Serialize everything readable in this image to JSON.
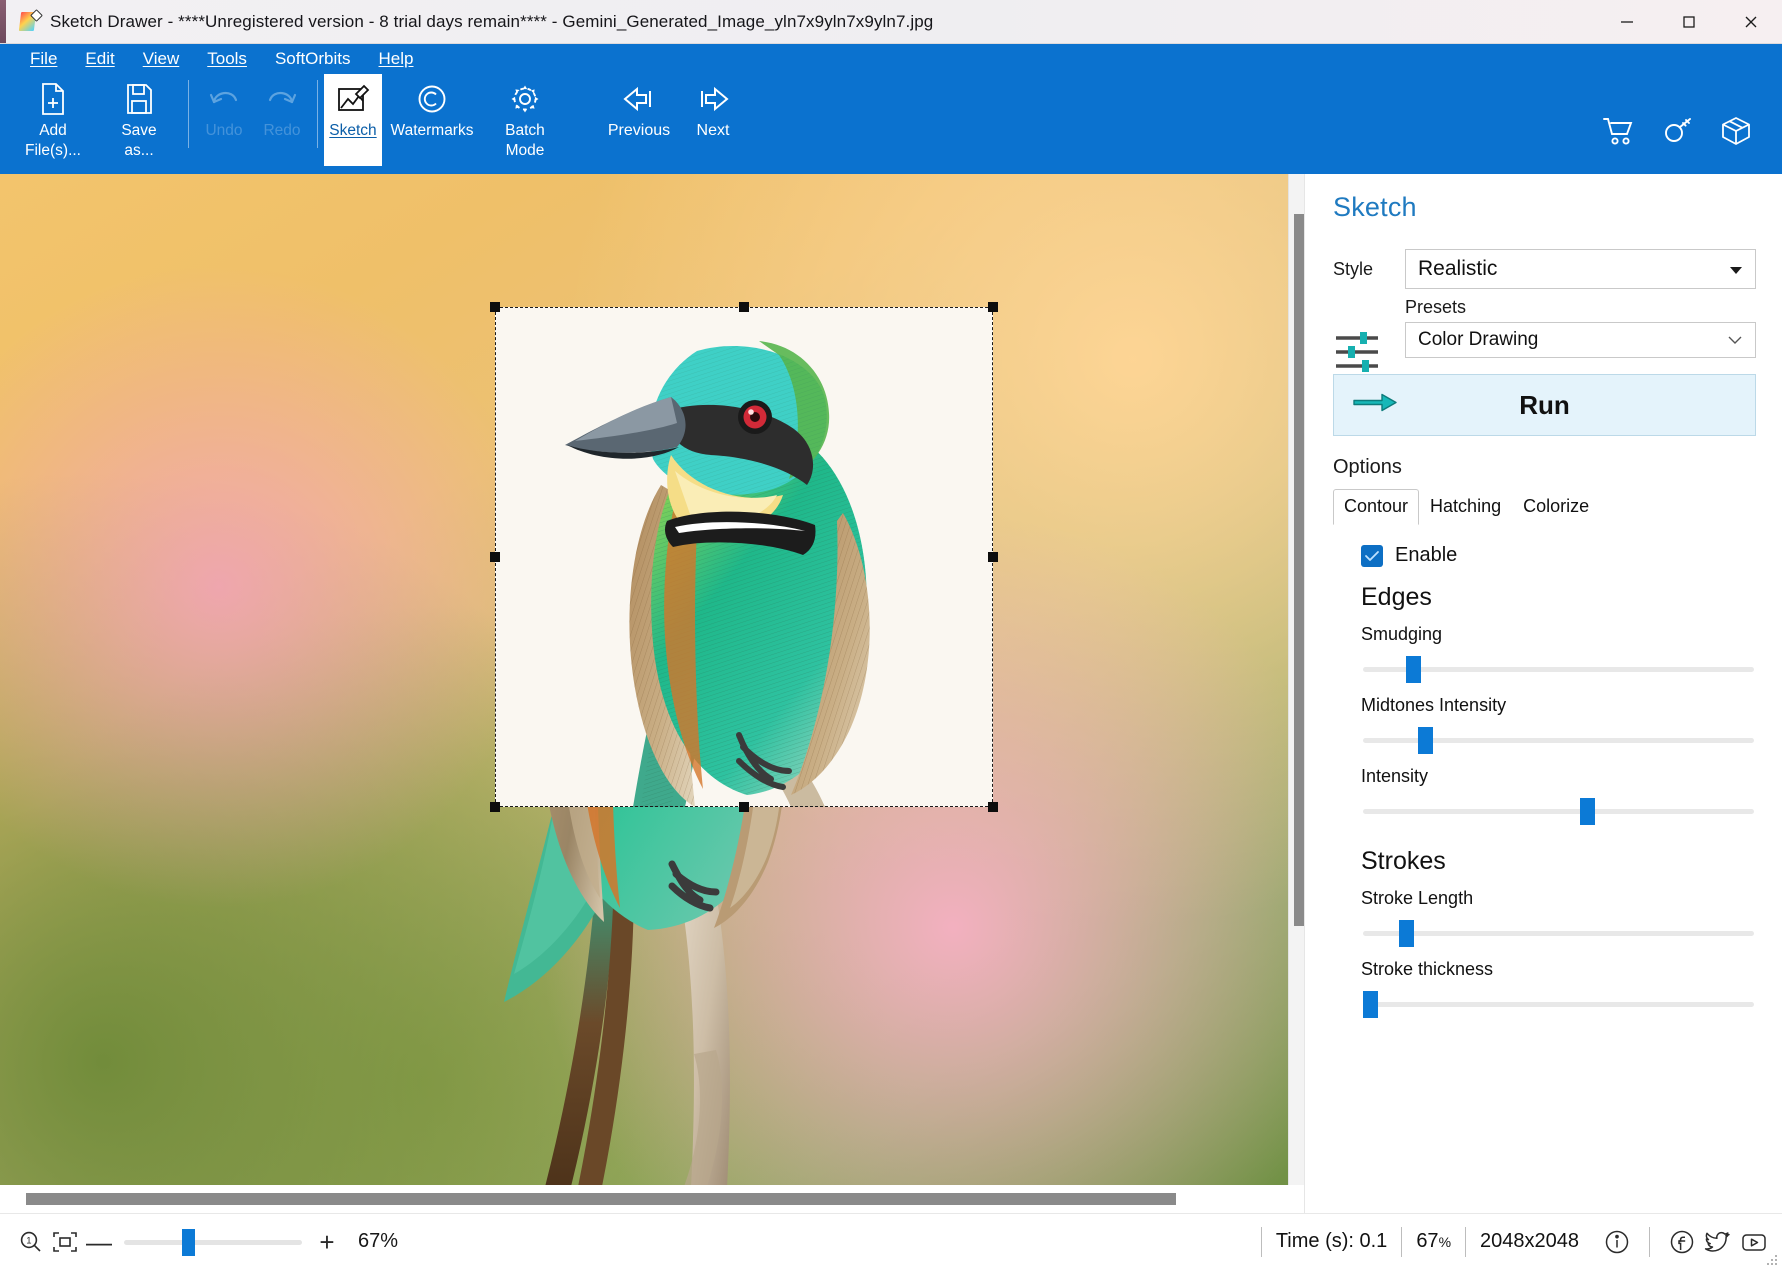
{
  "window": {
    "title": "Sketch Drawer - ****Unregistered version - 8 trial days remain**** - Gemini_Generated_Image_yln7x9yln7x9yln7.jpg",
    "app_icon": "sketch-drawer-logo",
    "minimize": "–",
    "maximize": "□",
    "close": "✕"
  },
  "menubar": {
    "items": [
      {
        "label": "File",
        "accel": "F"
      },
      {
        "label": "Edit",
        "accel": "E"
      },
      {
        "label": "View",
        "accel": "V"
      },
      {
        "label": "Tools",
        "accel": "T"
      },
      {
        "label": "SoftOrbits",
        "accel": ""
      },
      {
        "label": "Help",
        "accel": "H"
      }
    ]
  },
  "toolbar": {
    "items": [
      {
        "name": "add-files",
        "icon": "file-plus-icon",
        "line1": "Add",
        "line2": "File(s)...",
        "state": "enabled"
      },
      {
        "name": "save-as",
        "icon": "floppy-disk-icon",
        "line1": "Save",
        "line2": "as...",
        "state": "enabled"
      },
      {
        "name": "undo",
        "icon": "undo-arrow-icon",
        "line1": "Undo",
        "line2": "",
        "state": "disabled"
      },
      {
        "name": "redo",
        "icon": "redo-arrow-icon",
        "line1": "Redo",
        "line2": "",
        "state": "disabled"
      },
      {
        "name": "sketch",
        "icon": "sketch-pencil-icon",
        "line1": "Sketch",
        "line2": "",
        "state": "active"
      },
      {
        "name": "watermarks",
        "icon": "copyright-icon",
        "line1": "Watermarks",
        "line2": "",
        "state": "enabled"
      },
      {
        "name": "batch-mode",
        "icon": "gear-icon",
        "line1": "Batch",
        "line2": "Mode",
        "state": "enabled"
      },
      {
        "name": "previous",
        "icon": "arrow-left-icon",
        "line1": "Previous",
        "line2": "",
        "state": "enabled"
      },
      {
        "name": "next",
        "icon": "arrow-right-icon",
        "line1": "Next",
        "line2": "",
        "state": "enabled"
      }
    ],
    "right_icons": [
      {
        "name": "shopping-cart-icon",
        "title": "Buy"
      },
      {
        "name": "key-icon",
        "title": "Register"
      },
      {
        "name": "box-icon",
        "title": "Products"
      }
    ]
  },
  "panel": {
    "title": "Sketch",
    "style_label": "Style",
    "style_value": "Realistic",
    "presets_label": "Presets",
    "presets_value": "Color Drawing",
    "run_label": "Run",
    "options_label": "Options",
    "tabs": [
      {
        "label": "Contour",
        "active": true
      },
      {
        "label": "Hatching",
        "active": false
      },
      {
        "label": "Colorize",
        "active": false
      }
    ],
    "enable_label": "Enable",
    "enable_checked": true,
    "groups": [
      {
        "title": "Edges",
        "sliders": [
          {
            "label": "Smudging",
            "percent": 12
          },
          {
            "label": "Midtones Intensity",
            "percent": 15
          },
          {
            "label": "Intensity",
            "percent": 56
          }
        ]
      },
      {
        "title": "Strokes",
        "sliders": [
          {
            "label": "Stroke Length",
            "percent": 10
          },
          {
            "label": "Stroke thickness",
            "percent": 1
          }
        ]
      }
    ]
  },
  "statusbar": {
    "zoom_in_icon": "magnifier-one-icon",
    "fit_icon": "fit-to-screen-icon",
    "zoom_out_label": "—",
    "zoom_in_label": "+",
    "zoom_percent": "67%",
    "zoom_slider_percent": 33,
    "time_label": "Time (s): 0.1",
    "scale_value": "67",
    "scale_unit": "%",
    "dimensions": "2048x2048",
    "info_icon": "info-circle-icon",
    "facebook_icon": "facebook-icon",
    "twitter_icon": "twitter-bird-icon",
    "youtube_icon": "youtube-icon"
  },
  "canvas": {
    "image_name": "bee-eater-bird-photo",
    "selection": {
      "name": "sketch-preview-selection"
    }
  },
  "colors": {
    "ribbon_blue": "#0b72cf",
    "panel_title_blue": "#1f7ac0",
    "accent_slider": "#0c7ad6",
    "run_bg": "#e4f3fb",
    "checkbox_blue": "#0d6fc4"
  }
}
